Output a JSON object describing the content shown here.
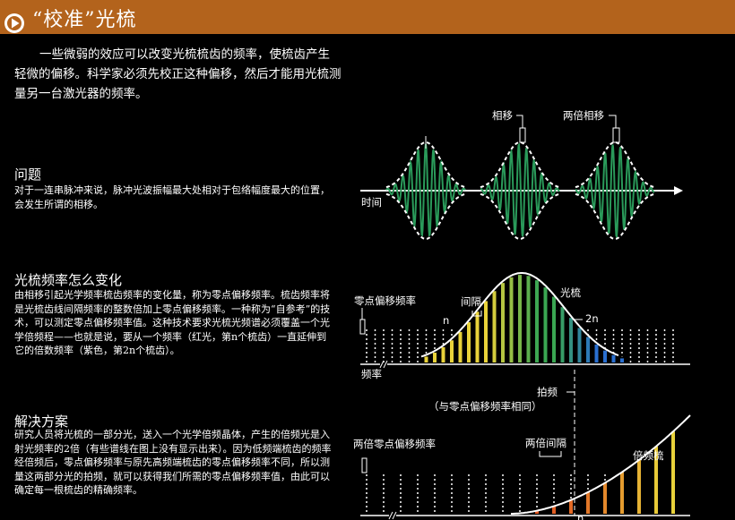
{
  "header": {
    "title": "“校准”光梳"
  },
  "intro": {
    "text": "一些微弱的效应可以改变光梳梳齿的频率，使梳齿产生轻微的偏移。科学家必须先校正这种偏移，然后才能用光梳测量另一台激光器的频率。"
  },
  "sections": {
    "problem": {
      "title": "问题",
      "body": "对于一连串脉冲来说，脉冲光波振幅最大处相对于包络幅度最大的位置，会发生所谓的相移。"
    },
    "change": {
      "title": "光梳频率怎么变化",
      "body": "由相移引起光学频率梳齿频率的变化量，称为零点偏移频率。梳齿频率将是光梳齿线间隔频率的整数倍加上零点偏移频率。一种称为“自参考”的技术，可以测定零点偏移频率值。这种技术要求光梳光频谱必须覆盖一个光学倍频程——也就是说，要从一个频率（红光，第n个梳齿）一直延伸到它的倍数频率（紫色，第2n个梳齿）。"
    },
    "solution": {
      "title": "解决方案",
      "body": "研究人员将光梳的一部分光，送入一个光学倍频晶体，产生的倍频光是入射光频率的2倍（有些谱线在图上没有显示出来）。因为低频端梳齿的频率经倍频后，零点偏移频率与原先高频端梳齿的零点偏移频率不同，所以测量这两部分光的拍频，就可以获得我们所需的零点偏移频率值，由此可以确定每一根梳齿的精确频率。"
    }
  },
  "diagram": {
    "pulse": {
      "time_label": "时间",
      "phase_label": "相移",
      "double_phase_label": "两倍相移"
    },
    "comb": {
      "offset_label": "零点偏移频率",
      "spacing_label": "间隔",
      "comb_label": "光梳",
      "n_label": "n",
      "n2_label": "2n",
      "freq_label": "频率"
    },
    "beat": {
      "label": "拍频",
      "note": "（与零点偏移频率相同）"
    },
    "doubled": {
      "offset_label": "两倍零点偏移频率",
      "spacing_label": "两倍间隔",
      "comb_label": "倍频梳",
      "n_label": "n"
    }
  },
  "colors": {
    "header_bg": "#b3631c",
    "wave": "#2a9a5a",
    "envelope": "#ffffff",
    "comb_green": "#3aa652",
    "comb_yellow": "#e8d23a",
    "comb_blue": "#2a6fd0"
  },
  "icons": {
    "play": "play-circle-icon"
  }
}
